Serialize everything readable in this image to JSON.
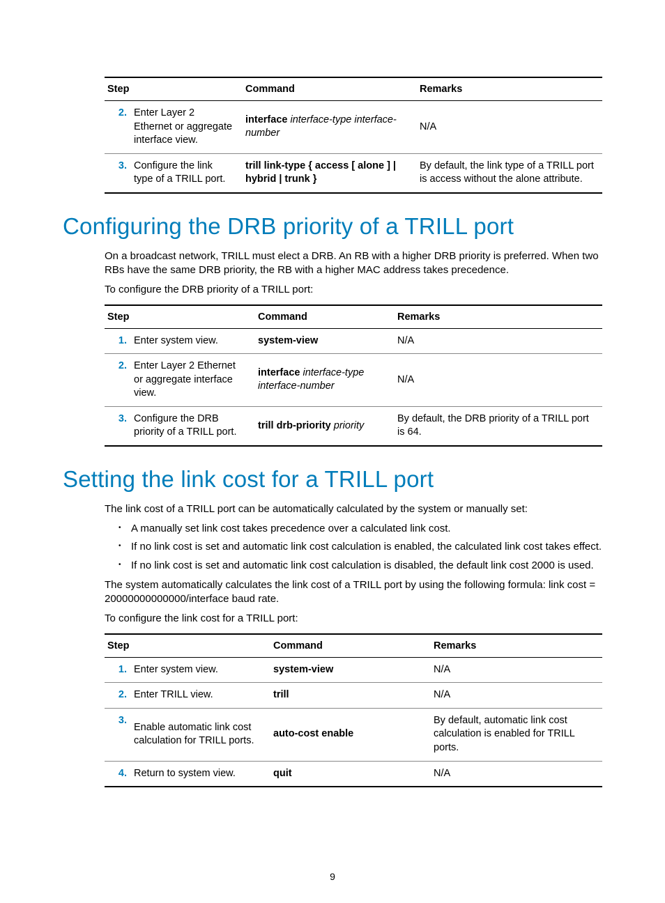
{
  "page_number": "9",
  "table1": {
    "headers": {
      "step": "Step",
      "command": "Command",
      "remarks": "Remarks"
    },
    "rows": [
      {
        "num": "2.",
        "desc": "Enter Layer 2 Ethernet or aggregate interface view.",
        "cmd_bold": "interface",
        "cmd_args": "interface-type interface-number",
        "remarks": "N/A"
      },
      {
        "num": "3.",
        "desc": "Configure the link type of a TRILL port.",
        "cmd_full": "trill link-type { access [ alone ] | hybrid | trunk }",
        "remarks": "By default, the link type of a TRILL port is access without the alone attribute."
      }
    ]
  },
  "section_drb": {
    "heading": "Configuring the DRB priority of a TRILL port",
    "para1": "On a broadcast network, TRILL must elect a DRB. An RB with a higher DRB priority is preferred. When two RBs have the same DRB priority, the RB with a higher MAC address takes precedence.",
    "para2": "To configure the DRB priority of a TRILL port:",
    "table": {
      "headers": {
        "step": "Step",
        "command": "Command",
        "remarks": "Remarks"
      },
      "rows": [
        {
          "num": "1.",
          "desc": "Enter system view.",
          "cmd_bold": "system-view",
          "remarks": "N/A"
        },
        {
          "num": "2.",
          "desc": "Enter Layer 2 Ethernet or aggregate interface view.",
          "cmd_bold": "interface",
          "cmd_args": "interface-type interface-number",
          "remarks": "N/A"
        },
        {
          "num": "3.",
          "desc": "Configure the DRB priority of a TRILL port.",
          "cmd_bold": "trill drb-priority",
          "cmd_args_inline": "priority",
          "remarks": "By default, the DRB priority of a TRILL port is 64."
        }
      ]
    }
  },
  "section_linkcost": {
    "heading": "Setting the link cost for a TRILL port",
    "para1": "The link cost of a TRILL port can be automatically calculated by the system or manually set:",
    "bullets": [
      "A manually set link cost takes precedence over a calculated link cost.",
      "If no link cost is set and automatic link cost calculation is enabled, the calculated link cost takes effect.",
      "If no link cost is set and automatic link cost calculation is disabled, the default link cost 2000 is used."
    ],
    "para2": "The system automatically calculates the link cost of a TRILL port by using the following formula: link cost = 20000000000000/interface baud rate.",
    "para3": "To configure the link cost for a TRILL port:",
    "table": {
      "headers": {
        "step": "Step",
        "command": "Command",
        "remarks": "Remarks"
      },
      "rows": [
        {
          "num": "1.",
          "desc": "Enter system view.",
          "cmd_bold": "system-view",
          "remarks": "N/A"
        },
        {
          "num": "2.",
          "desc": "Enter TRILL view.",
          "cmd_bold": "trill",
          "remarks": "N/A"
        },
        {
          "num": "3.",
          "desc": "Enable automatic link cost calculation for TRILL ports.",
          "cmd_bold": "auto-cost enable",
          "remarks": "By default, automatic link cost calculation is enabled for TRILL ports."
        },
        {
          "num": "4.",
          "desc": "Return to system view.",
          "cmd_bold": "quit",
          "remarks": "N/A"
        }
      ]
    }
  }
}
